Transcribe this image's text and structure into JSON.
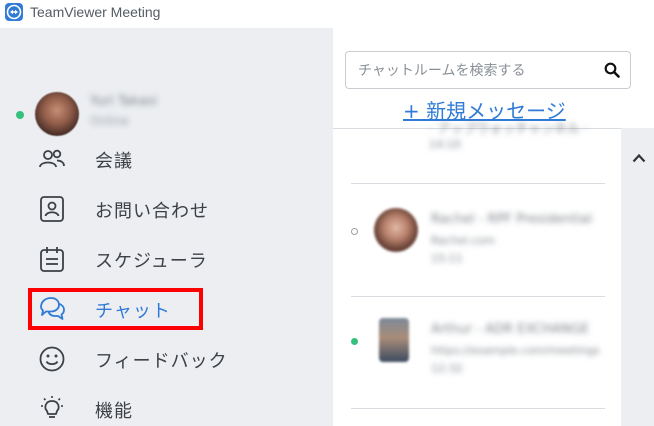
{
  "window": {
    "title": "TeamViewer Meeting"
  },
  "profile": {
    "name": "Yuri Takasi",
    "subtitle": "Online"
  },
  "nav": {
    "items": [
      {
        "label": "会議",
        "icon": "people-icon"
      },
      {
        "label": "お問い合わせ",
        "icon": "contact-icon"
      },
      {
        "label": "スケジューラ",
        "icon": "calendar-icon"
      },
      {
        "label": "チャット",
        "icon": "chat-icon",
        "active": true
      },
      {
        "label": "フィードバック",
        "icon": "smiley-icon"
      },
      {
        "label": "機能",
        "icon": "lightbulb-icon"
      }
    ]
  },
  "search": {
    "placeholder": "チャットルームを検索する"
  },
  "new_message": {
    "label": "+ 新規メッセージ"
  },
  "conversations": [
    {
      "title": "· アップウォッチャンネル ·",
      "preview": "14:10",
      "time": "",
      "status": "none"
    },
    {
      "title": "Rachel - RPF Presidential",
      "preview": "Rachel.com",
      "time": "15:11",
      "status": "offline"
    },
    {
      "title": "Arthur - ADR EXCHANGE",
      "preview": "https://example.com/meetings",
      "time": "12:32",
      "status": "online"
    }
  ],
  "colors": {
    "accent": "#2f7bd6",
    "online": "#35c17b",
    "highlight": "#ff0000",
    "sidebar_bg": "#eceef1"
  }
}
